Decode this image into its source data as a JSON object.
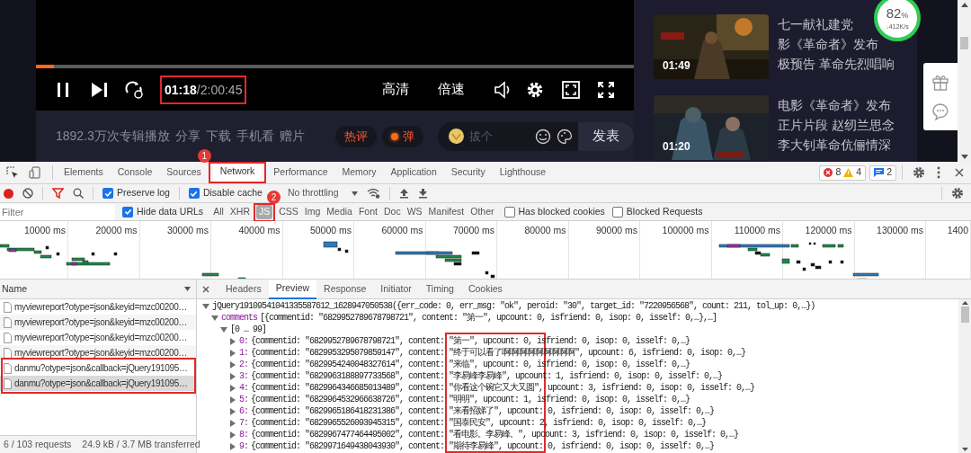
{
  "player": {
    "progress": {
      "level": 0.03
    },
    "time": {
      "current": "01:18",
      "total": "/2:00:45",
      "annotated": true
    },
    "buttons": [
      "高清",
      "倍速"
    ],
    "info": {
      "plays": "1892.3万次专辑播放",
      "actions": [
        "分享",
        "下载",
        "手机看",
        "赠片"
      ],
      "tags": [
        {
          "label": "热评",
          "kind": "text"
        },
        {
          "label": "弹",
          "kind": "dot"
        }
      ],
      "comment_placeholder": "拔个",
      "post": "发表"
    }
  },
  "recommendations": [
    {
      "lines": [
        "七一献礼建党",
        "影《革命者》发布",
        "极预告 革命先烈唱响"
      ],
      "duration": "01:49"
    },
    {
      "lines": [
        "电影《革命者》发布",
        "正片片段 赵纫兰思念",
        "李大钊革命伉俪情深"
      ],
      "duration": "01:20"
    }
  ],
  "speed_widget": {
    "percent": "82",
    "unit": "%",
    "arrow": "↓",
    "rate": "412K/s"
  },
  "devtools": {
    "tabs": [
      {
        "label": "Elements",
        "selected": false,
        "annotated": false
      },
      {
        "label": "Console",
        "selected": false,
        "annotated": false
      },
      {
        "label": "Sources",
        "selected": false,
        "annotated": false
      },
      {
        "label": "Network",
        "selected": true,
        "annotated": true
      },
      {
        "label": "Performance",
        "selected": false,
        "annotated": false
      },
      {
        "label": "Memory",
        "selected": false,
        "annotated": false
      },
      {
        "label": "Application",
        "selected": false,
        "annotated": false
      },
      {
        "label": "Security",
        "selected": false,
        "annotated": false
      },
      {
        "label": "Lighthouse",
        "selected": false,
        "annotated": false
      }
    ],
    "counts": {
      "errors": "8",
      "warnings": "4",
      "messages": "2"
    },
    "toolbar": {
      "preserve_log": {
        "label": "Preserve log",
        "checked": true
      },
      "disable_cache": {
        "label": "Disable cache",
        "checked": true
      },
      "throttling": "No throttling"
    },
    "filter": {
      "placeholder": "Filter",
      "hide_data_urls": {
        "label": "Hide data URLs",
        "checked": true
      },
      "types": [
        {
          "label": "All",
          "selected": false,
          "annotated": false
        },
        {
          "label": "XHR",
          "selected": false,
          "annotated": false
        },
        {
          "label": "JS",
          "selected": true,
          "annotated": true
        },
        {
          "label": "CSS",
          "selected": false,
          "annotated": false
        },
        {
          "label": "Img",
          "selected": false,
          "annotated": false
        },
        {
          "label": "Media",
          "selected": false,
          "annotated": false
        },
        {
          "label": "Font",
          "selected": false,
          "annotated": false
        },
        {
          "label": "Doc",
          "selected": false,
          "annotated": false
        },
        {
          "label": "WS",
          "selected": false,
          "annotated": false
        },
        {
          "label": "Manifest",
          "selected": false,
          "annotated": false
        },
        {
          "label": "Other",
          "selected": false,
          "annotated": false
        }
      ],
      "blocked_cookies": {
        "label": "Has blocked cookies",
        "checked": false
      },
      "blocked_requests": {
        "label": "Blocked Requests",
        "checked": false
      }
    },
    "timeline_ticks": [
      "10000 ms",
      "20000 ms",
      "30000 ms",
      "40000 ms",
      "50000 ms",
      "60000 ms",
      "70000 ms",
      "80000 ms",
      "90000 ms",
      "100000 ms",
      "110000 ms",
      "120000 ms",
      "130000 ms",
      "1400"
    ],
    "requests": {
      "column": "Name",
      "rows": [
        {
          "name": "myviewreport?otype=json&keyid=mzc00200…",
          "selected": false,
          "annotated": false
        },
        {
          "name": "myviewreport?otype=json&keyid=mzc00200…",
          "selected": false,
          "annotated": false
        },
        {
          "name": "myviewreport?otype=json&keyid=mzc00200…",
          "selected": false,
          "annotated": false
        },
        {
          "name": "myviewreport?otype=json&keyid=mzc00200…",
          "selected": false,
          "annotated": false
        },
        {
          "name": "danmu?otype=json&callback=jQuery191095…",
          "selected": false,
          "annotated": true
        },
        {
          "name": "danmu?otype=json&callback=jQuery191095…",
          "selected": true,
          "annotated": true
        }
      ],
      "summary": "6 / 103 requests",
      "transferred": "24.9 kB / 3.7 MB transferred"
    },
    "detail_tabs": [
      {
        "label": "Headers",
        "selected": false
      },
      {
        "label": "Preview",
        "selected": true
      },
      {
        "label": "Response",
        "selected": false
      },
      {
        "label": "Initiator",
        "selected": false
      },
      {
        "label": "Timing",
        "selected": false
      },
      {
        "label": "Cookies",
        "selected": false
      }
    ],
    "preview": {
      "root": {
        "text": "jQuery19109541041335587612_1628947050538({err_code: 0, err_msg: \"ok\", peroid: \"30\", target_id: \"7220956568\", count: 211, tol_up: 0,…})",
        "expanded": true
      },
      "comments": {
        "key": "comments",
        "text": "[{commentid: \"6829952789678798721\", content: \"第一\", upcount: 0, isfriend: 0, isop: 0, isself: 0,…},…]",
        "expanded": true
      },
      "range": {
        "text": "[0 … 99]",
        "expanded": true
      },
      "items": [
        {
          "index": "0:",
          "text": "{commentid: \"6829952789678798721\", content: \"第一\", upcount: 0, isfriend: 0, isop: 0, isself: 0,…}",
          "expanded": false
        },
        {
          "index": "1:",
          "text": "{commentid: \"6829953295079859147\", content: \"终于可以看了啊啊啊啊啊啊啊啊啊\", upcount: 6, isfriend: 0, isop: 0,…}",
          "expanded": false
        },
        {
          "index": "2:",
          "text": "{commentid: \"6829954240048327614\", content: \"来临\", upcount: 0, isfriend: 0, isop: 0, isself: 0,…}",
          "expanded": false
        },
        {
          "index": "3:",
          "text": "{commentid: \"6829963188897733568\", content: \"李易峰李易峰\", upcount: 1, isfriend: 0, isop: 0, isself: 0,…}",
          "expanded": false
        },
        {
          "index": "4:",
          "text": "{commentid: \"6829964346685013489\", content: \"你看这个碗它又大又圆\", upcount: 3, isfriend: 0, isop: 0, isself: 0,…}",
          "expanded": false
        },
        {
          "index": "5:",
          "text": "{commentid: \"6829964532966638726\", content: \"明明\", upcount: 1, isfriend: 0, isop: 0, isself: 0,…}",
          "expanded": false
        },
        {
          "index": "6:",
          "text": "{commentid: \"6829965186418231386\", content: \"来看招娣了\", upcount: 0, isfriend: 0, isop: 0, isself: 0,…}",
          "expanded": false
        },
        {
          "index": "7:",
          "text": "{commentid: \"6829965526093945315\", content: \"国泰民安\", upcount: 2, isfriend: 0, isop: 0, isself: 0,…}",
          "expanded": false
        },
        {
          "index": "8:",
          "text": "{commentid: \"6829967477464495002\", content: \"看电影。李易峰。\", upcount: 3, isfriend: 0, isop: 0, isself: 0,…}",
          "expanded": false
        },
        {
          "index": "9:",
          "text": "{commentid: \"6829971649438043930\", content: \"期待李易峰\", upcount: 0, isfriend: 0, isop: 0, isself: 0,…}",
          "expanded": false
        }
      ]
    }
  },
  "annotations": {
    "badges": [
      "1",
      "2"
    ]
  }
}
